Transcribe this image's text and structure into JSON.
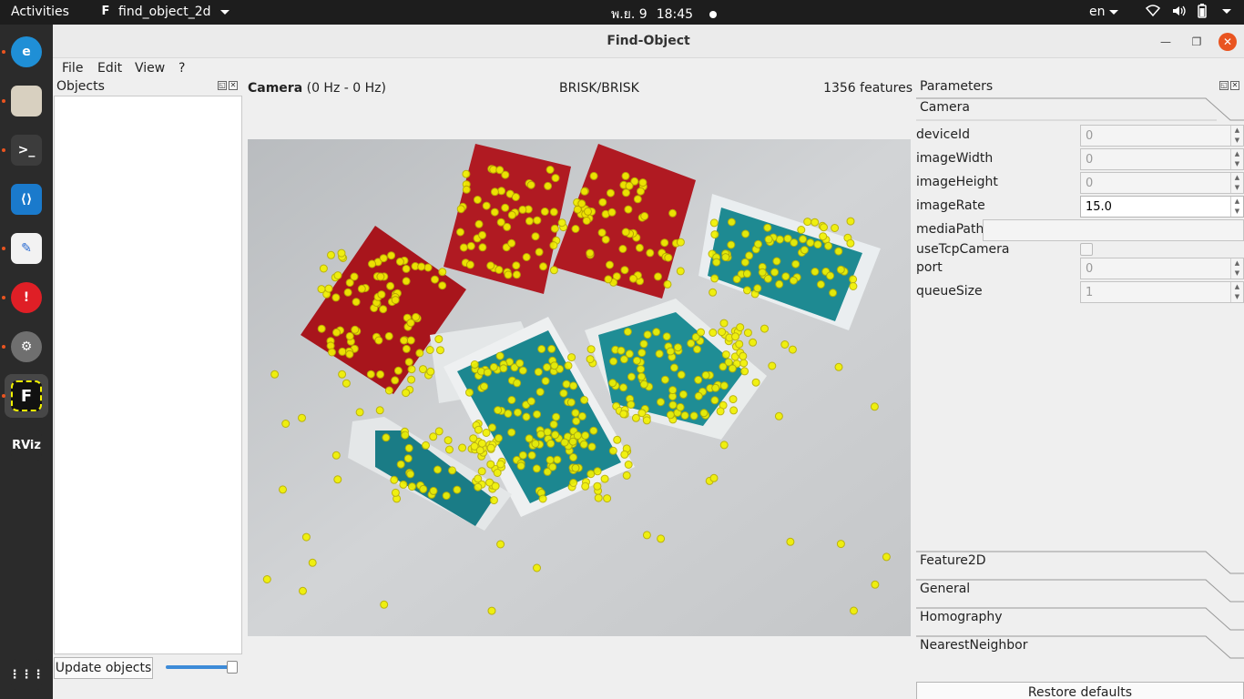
{
  "topbar": {
    "activities": "Activities",
    "app_name": "find_object_2d",
    "app_icon_glyph": "F",
    "date": "พ.ย. 9",
    "time": "18:45",
    "language": "en"
  },
  "dock": {
    "items": [
      {
        "name": "edge-browser-icon",
        "label": "e",
        "color": "#1f8fd6"
      },
      {
        "name": "files-icon",
        "label": "",
        "color": "#d8d0c0"
      },
      {
        "name": "terminal-icon",
        "label": ">_",
        "color": "#3c3c3c"
      },
      {
        "name": "vscode-icon",
        "label": "⟨⟩",
        "color": "#1a7acc"
      },
      {
        "name": "text-editor-icon",
        "label": "✎",
        "color": "#f2f2f2"
      },
      {
        "name": "error-reporter-icon",
        "label": "!",
        "color": "#df1f26"
      },
      {
        "name": "settings-icon",
        "label": "⚙",
        "color": "#6f6f6f"
      },
      {
        "name": "find-object-icon",
        "label": "F",
        "color": "#111111"
      },
      {
        "name": "rviz-icon",
        "label": "RViz",
        "color": "#2b2b2b"
      },
      {
        "name": "show-apps-icon",
        "label": "⋮⋮⋮",
        "color": "#2b2b2b"
      }
    ]
  },
  "window": {
    "title": "Find-Object",
    "menu": [
      "File",
      "Edit",
      "View",
      "?"
    ]
  },
  "objects_panel": {
    "title": "Objects",
    "update_button": "Update objects",
    "slider_value": 0.95
  },
  "camera": {
    "title": "Camera",
    "rate": "(0 Hz - 0 Hz)",
    "detector": "BRISK/BRISK",
    "features": "1356 features"
  },
  "parameters": {
    "title": "Parameters",
    "camera_section": "Camera",
    "rows": [
      {
        "label": "deviceId",
        "value": "0"
      },
      {
        "label": "imageWidth",
        "value": "0"
      },
      {
        "label": "imageHeight",
        "value": "0"
      },
      {
        "label": "imageRate",
        "value": "15.0"
      },
      {
        "label": "mediaPath",
        "value": ""
      },
      {
        "label": "useTcpCamera",
        "value": ""
      },
      {
        "label": "port",
        "value": "0"
      },
      {
        "label": "queueSize",
        "value": "1"
      }
    ],
    "sections": [
      "Feature2D",
      "General",
      "Homography",
      "NearestNeighbor"
    ],
    "restore_button": "Restore defaults"
  }
}
